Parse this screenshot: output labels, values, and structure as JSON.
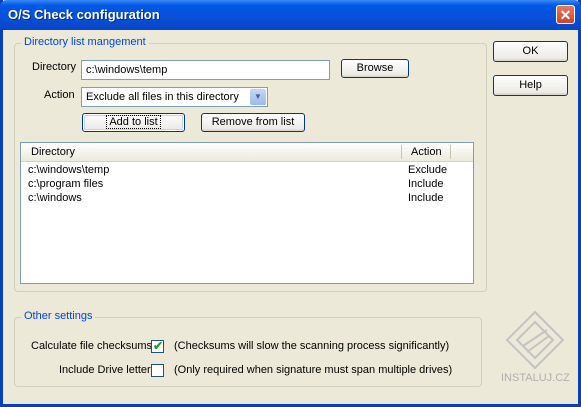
{
  "window": {
    "title": "O/S Check configuration",
    "close_glyph": "✕"
  },
  "buttons": {
    "ok": "OK",
    "help": "Help",
    "browse": "Browse",
    "add": "Add to list",
    "remove": "Remove from list"
  },
  "directory_group": {
    "legend": "Directory list mangement",
    "directory_label": "Directory",
    "directory_value": "c:\\windows\\temp",
    "action_label": "Action",
    "action_value": "Exclude all files in this directory"
  },
  "list": {
    "columns": [
      "Directory",
      "Action"
    ],
    "rows": [
      {
        "directory": "c:\\windows\\temp",
        "action": "Exclude"
      },
      {
        "directory": "c:\\program files",
        "action": "Include"
      },
      {
        "directory": "c:\\windows",
        "action": "Include"
      }
    ]
  },
  "other_group": {
    "legend": "Other settings",
    "checksums_label": "Calculate file checksums",
    "checksums_checked": true,
    "checksums_note": "(Checksums will slow the scanning process significantly)",
    "drive_label": "Include Drive letter",
    "drive_checked": false,
    "drive_note": "(Only required when signature must span multiple drives)"
  },
  "watermark": {
    "text": "INSTALUJ.CZ"
  },
  "icons": {
    "close": "close-icon",
    "dropdown": "chevron-down-icon",
    "check": "checkmark-icon",
    "watermark": "instaluj-logo-icon"
  }
}
